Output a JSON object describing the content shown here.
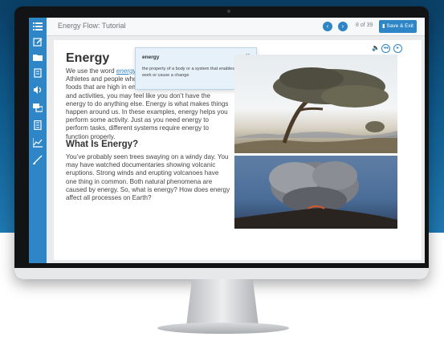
{
  "app": {
    "title": "Energy Flow: Tutorial"
  },
  "nav": {
    "prev_icon": "chevron-left-icon",
    "next_icon": "chevron-right-icon",
    "page_current": "8",
    "page_of": "of",
    "page_total": "39"
  },
  "toolbar": {
    "save_label": "Save & Exit"
  },
  "sidebar": {
    "icons": [
      "menu-icon",
      "edit-icon",
      "folder-icon",
      "notebook-icon",
      "audio-icon",
      "chat-icon",
      "document-icon",
      "chart-icon",
      "pen-icon"
    ]
  },
  "media": {
    "speaker_icon": "speaker-icon",
    "rewind_icon": "rewind-icon",
    "play_icon": "play-icon"
  },
  "content": {
    "heading": "Energy",
    "para1_l1a": "We use the word ",
    "para1_term": "energy",
    "para1_l2": "Athletes and people who",
    "para1_l3": "foods that are high in en",
    "para1_rest": "and activities, you may feel like you don’t have the energy to do anything else. Energy is what makes things happen around us. In these examples, energy helps you perform some activity. Just as you need energy to perform tasks, different systems require energy to function properly.",
    "subheading": "What Is Energy?",
    "para2": "You’ve probably seen trees swaying on a windy day. You may have watched documentaries showing volcanic eruptions. Strong winds and erupting volcanoes have one thing in common. Both natural phenomena are caused by energy. So, what is energy? How does energy affect all processes on Earth?"
  },
  "tooltip": {
    "title": "energy",
    "close": "×",
    "definition": "the property of a body or a system that enables it to do work or cause a change"
  },
  "colors": {
    "accent": "#2f86c6",
    "sidebar": "#2f86c6"
  }
}
